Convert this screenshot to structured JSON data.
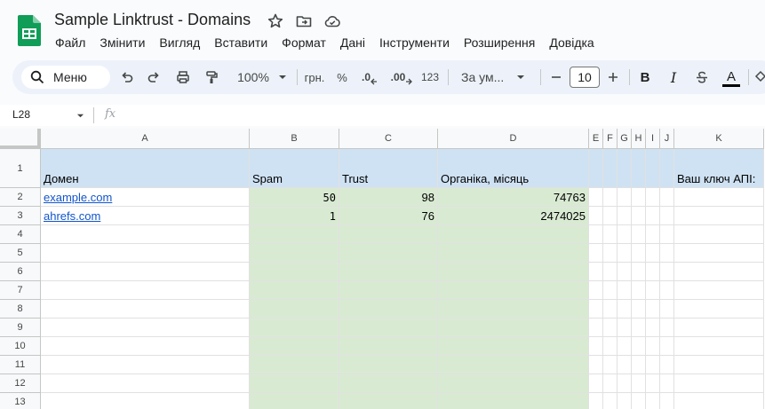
{
  "doc": {
    "title": "Sample Linktrust - Domains"
  },
  "menu": [
    "Файл",
    "Змінити",
    "Вигляд",
    "Вставити",
    "Формат",
    "Дані",
    "Інструменти",
    "Розширення",
    "Довідка"
  ],
  "toolbar": {
    "search_label": "Меню",
    "zoom": "100%",
    "currency": "грн.",
    "percent": "%",
    "decimal_decrease": ".0",
    "decimal_increase": ".00",
    "number_format": "123",
    "font_family": "За ум...",
    "font_size": "10",
    "bold": "B",
    "italic": "I",
    "text_color": "A"
  },
  "formula_bar": {
    "name_box": "L28",
    "fx": "fx"
  },
  "sheet": {
    "columns": [
      "A",
      "B",
      "C",
      "D",
      "E",
      "F",
      "G",
      "H",
      "I",
      "J",
      "K"
    ],
    "row_numbers": [
      "1",
      "2",
      "3",
      "4",
      "5",
      "6",
      "7",
      "8",
      "9",
      "10",
      "11",
      "12",
      "13"
    ],
    "header": {
      "domain": "Домен",
      "spam": "Spam",
      "trust": "Trust",
      "organic": "Органіка, місяць",
      "api_key": "Ваш ключ АПІ:"
    },
    "rows": [
      {
        "domain": "example.com",
        "spam": "50",
        "trust": "98",
        "organic": "74763"
      },
      {
        "domain": "ahrefs.com",
        "spam": "1",
        "trust": "76",
        "organic": "2474025"
      }
    ]
  },
  "colors": {
    "header_fill": "#cfe2f3",
    "metric_fill": "#d9ead3",
    "link": "#1155cc",
    "logo": "#0f9d58"
  }
}
